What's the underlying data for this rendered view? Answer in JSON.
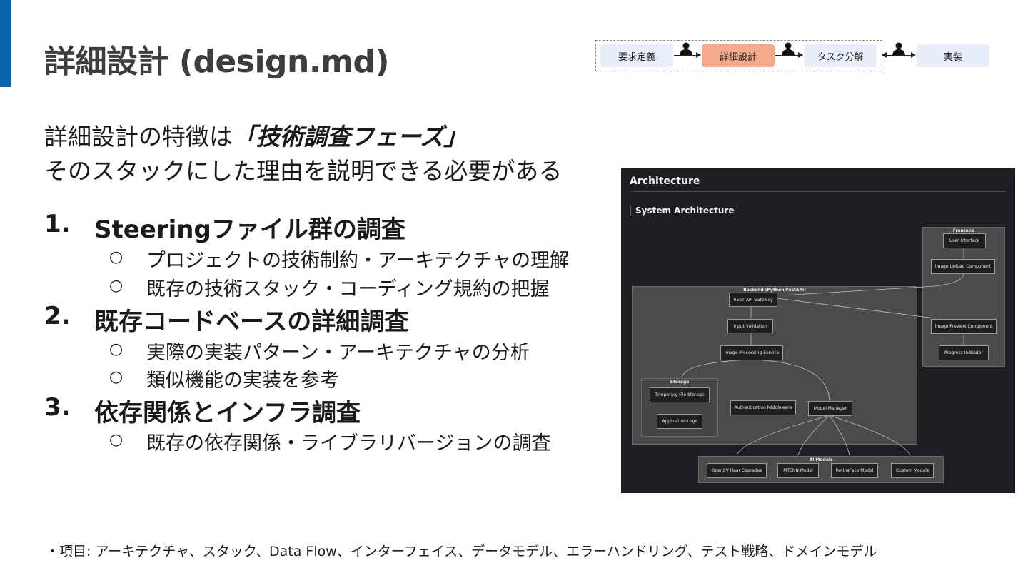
{
  "title": "詳細設計 (design.md)",
  "flow": {
    "steps": [
      "要求定義",
      "詳細設計",
      "タスク分解",
      "実装"
    ],
    "active_step": "詳細設計",
    "icon": "person-icon"
  },
  "lead": {
    "prefix": "詳細設計の特徴は",
    "emphasis": "「技術調査フェーズ」",
    "line2": "そのスタックにした理由を説明できる必要がある"
  },
  "items": [
    {
      "number": "1.",
      "label": "Steeringファイル群の調査",
      "subitems": [
        "プロジェクトの技術制約・アーキテクチャの理解",
        "既存の技術スタック・コーディング規約の把握"
      ]
    },
    {
      "number": "2.",
      "label": "既存コードベースの詳細調査",
      "subitems": [
        "実際の実装パターン・アーキテクチャの分析",
        "類似機能の実装を参考"
      ]
    },
    {
      "number": "3.",
      "label": "依存関係とインフラ調査",
      "subitems": [
        "既存の依存関係・ライブラリバージョンの調査"
      ]
    }
  ],
  "bullet_symbol": "○",
  "architecture": {
    "heading": "Architecture",
    "subheading": "System Architecture",
    "groups": {
      "frontend": "Frontend",
      "backend": "Backend (Python/FastAPI)",
      "storage": "Storage",
      "ai": "AI Models"
    },
    "nodes": {
      "user_interface": "User Interface",
      "image_upload": "Image Upload Component",
      "image_preview": "Image Preview Component",
      "progress": "Progress Indicator",
      "rest_api": "REST API Gateway",
      "input_validation": "Input Validation",
      "image_processing": "Image Processing Service",
      "temp_storage": "Temporary File Storage",
      "app_logs": "Application Logs",
      "auth": "Authentication Middleware",
      "model_manager": "Model Manager",
      "opencv": "OpenCV Haar Cascades",
      "mtcnn": "MTCNN Model",
      "retinaface": "RetinaFace Model",
      "custom": "Custom Models"
    }
  },
  "footer": "・項目: アーキテクチャ、スタック、Data Flow、インターフェイス、データモデル、エラーハンドリング、テスト戦略、ドメインモデル",
  "colors": {
    "accent": "#0b63ac",
    "active_step": "#f6a98b",
    "step": "#e7eef9",
    "diagram_bg": "#1e1e22"
  }
}
